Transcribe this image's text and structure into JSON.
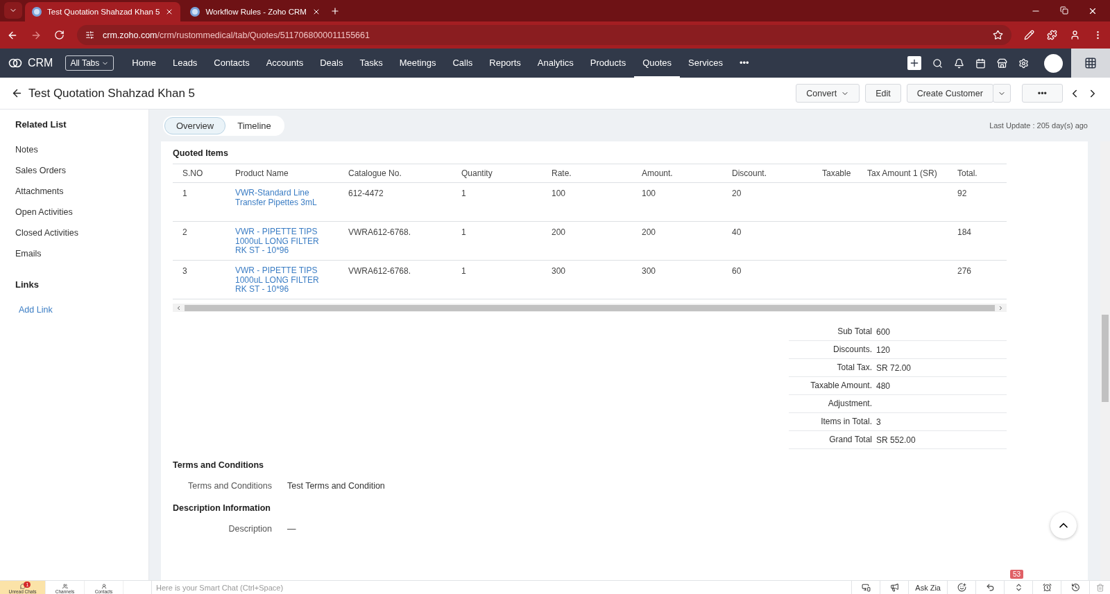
{
  "browser": {
    "tabs": [
      {
        "title": "Test Quotation Shahzad Khan 5",
        "selected": true
      },
      {
        "title": "Workflow Rules - Zoho CRM",
        "selected": false
      }
    ],
    "url": {
      "host": "crm.zoho.com",
      "path": "/crm/rustommedical/tab/Quotes/5117068000011155661"
    }
  },
  "nav": {
    "brand": "CRM",
    "all_tabs": "All Tabs",
    "items": [
      {
        "label": "Home",
        "selected": false
      },
      {
        "label": "Leads",
        "selected": false
      },
      {
        "label": "Contacts",
        "selected": false
      },
      {
        "label": "Accounts",
        "selected": false
      },
      {
        "label": "Deals",
        "selected": false
      },
      {
        "label": "Tasks",
        "selected": false
      },
      {
        "label": "Meetings",
        "selected": false
      },
      {
        "label": "Calls",
        "selected": false
      },
      {
        "label": "Reports",
        "selected": false
      },
      {
        "label": "Analytics",
        "selected": false
      },
      {
        "label": "Products",
        "selected": false
      },
      {
        "label": "Quotes",
        "selected": true
      },
      {
        "label": "Services",
        "selected": false
      }
    ],
    "more": "•••"
  },
  "header": {
    "title": "Test Quotation Shahzad Khan 5",
    "buttons": [
      "Convert",
      "Edit",
      "Create Customer"
    ],
    "more": "•••"
  },
  "sidebar": {
    "heading": "Related List",
    "items": [
      "Notes",
      "Sales Orders",
      "Attachments",
      "Open Activities",
      "Closed Activities",
      "Emails"
    ],
    "links_heading": "Links",
    "add_link": "Add Link"
  },
  "view_tabs": [
    {
      "label": "Overview",
      "selected": true
    },
    {
      "label": "Timeline",
      "selected": false
    }
  ],
  "last_update": "Last Update : 205 day(s) ago",
  "quoted_items": {
    "title": "Quoted Items",
    "columns": [
      "S.NO",
      "Product Name",
      "Catalogue No.",
      "Quantity",
      "Rate.",
      "Amount.",
      "Discount.",
      "Taxable",
      "Tax Amount 1 (SR)",
      "Total."
    ],
    "rows": [
      [
        "1",
        "VWR-Standard Line Transfer Pipettes 3mL",
        "612-4472",
        "1",
        "100",
        "100",
        "20",
        "",
        "",
        "92"
      ],
      [
        "2",
        "VWR - PIPETTE TIPS 1000uL LONG FILTER RK ST - 10*96",
        "VWRA612-6768.",
        "1",
        "200",
        "200",
        "40",
        "",
        "",
        "184"
      ],
      [
        "3",
        "VWR - PIPETTE TIPS 1000uL LONG FILTER RK ST - 10*96",
        "VWRA612-6768.",
        "1",
        "300",
        "300",
        "60",
        "",
        "",
        "276"
      ]
    ]
  },
  "summary": [
    {
      "label": "Sub Total",
      "value": "600"
    },
    {
      "label": "Discounts.",
      "value": "120"
    },
    {
      "label": "Total Tax.",
      "value": "SR 72.00"
    },
    {
      "label": "Taxable Amount.",
      "value": "480"
    },
    {
      "label": "Adjustment."
    },
    {
      "label": "Items in Total.",
      "value": "3"
    },
    {
      "label": "Grand Total",
      "value": "SR 552.00"
    }
  ],
  "terms": {
    "title": "Terms and Conditions",
    "label": "Terms and Conditions",
    "value": "Test Terms and Condition"
  },
  "description": {
    "title": "Description Information",
    "label": "Description",
    "value": "—"
  },
  "bottom_bar": {
    "tabs": [
      {
        "label": "Unread Chats",
        "badge": "1",
        "selected": true
      },
      {
        "label": "Channels",
        "selected": false
      },
      {
        "label": "Contacts",
        "selected": false
      }
    ],
    "chat_placeholder": "Here is your Smart Chat (Ctrl+Space)",
    "ask_zia": "Ask Zia",
    "notification_count": "53"
  }
}
